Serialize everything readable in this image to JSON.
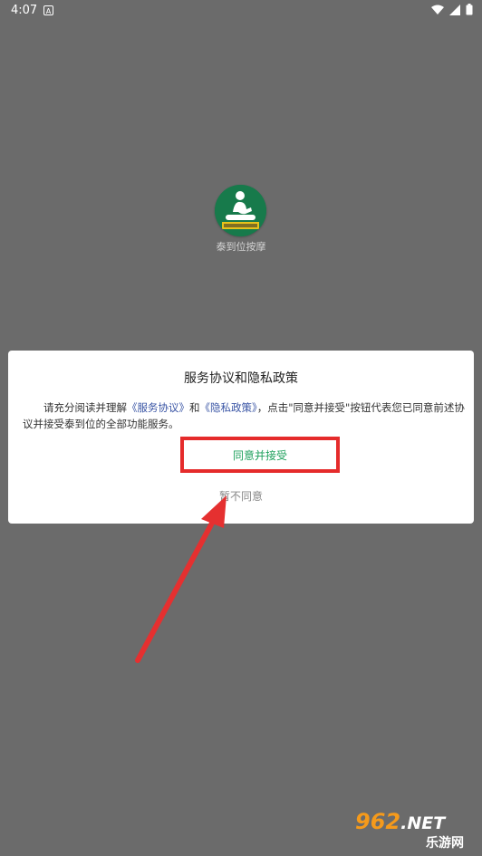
{
  "status_bar": {
    "time": "4:07",
    "notification_icon": "a-badge-icon",
    "icons": [
      "wifi-icon",
      "signal-icon",
      "battery-icon"
    ]
  },
  "home": {
    "app_label": "泰到位按摩"
  },
  "dialog": {
    "title": "服务协议和隐私政策",
    "body_prefix": "请充分阅读并理解",
    "link_service": "《服务协议》",
    "body_and": "和",
    "link_privacy": "《隐私政策》",
    "body_suffix": "，点击\"同意并接受\"按钮代表您已同意前述协议并接受泰到位的全部功能服务。",
    "accept_label": "同意并接受",
    "decline_label": "暂不同意"
  },
  "annotation": {
    "highlight_color": "#e52b2b",
    "arrow_color": "#e53030"
  },
  "watermark": {
    "number": "962",
    "suffix": ".NET",
    "subtitle": "乐游网"
  },
  "colors": {
    "overlay": "#6b6b6b",
    "accent_green": "#1fa15d",
    "link_blue": "#3a55a5"
  }
}
